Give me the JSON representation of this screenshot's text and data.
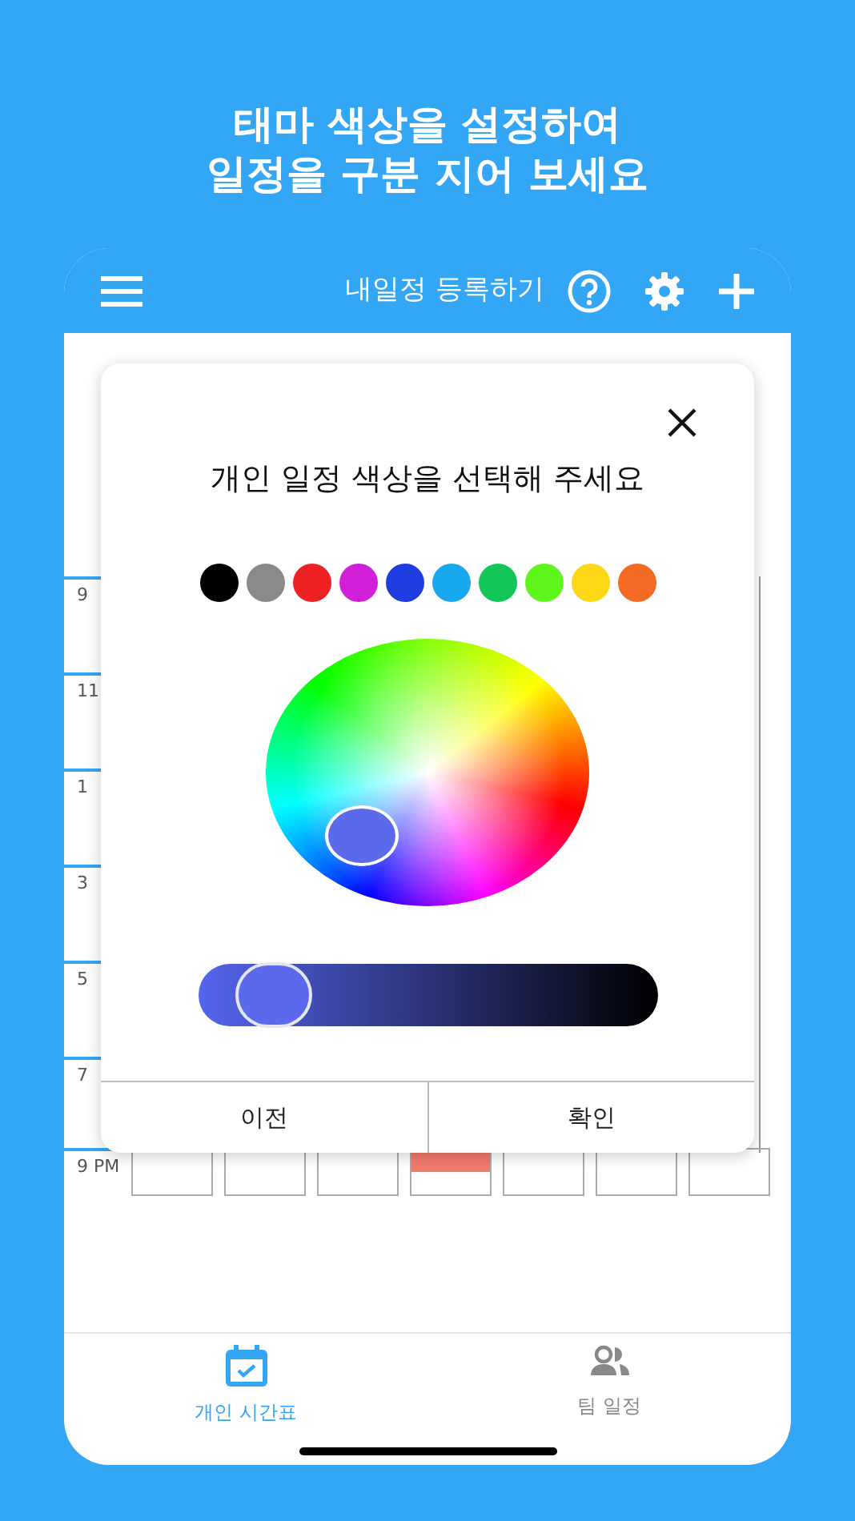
{
  "headline": [
    "태마 색상을 설정하여",
    "일정을 구분 지어 보세요"
  ],
  "header": {
    "title": "내일정 등록하기"
  },
  "timetable": {
    "times": [
      "9",
      "11",
      "1",
      "3",
      "5",
      "7"
    ],
    "last_row": {
      "time": "9 PM",
      "cells": [
        {
          "filled": false
        },
        {
          "filled": false
        },
        {
          "filled": false
        },
        {
          "filled": true
        },
        {
          "filled": false
        },
        {
          "filled": false
        },
        {
          "filled": false
        }
      ]
    }
  },
  "dialog": {
    "title": "개인 일정 색상을 선택해 주세요",
    "swatches": [
      {
        "color": "#000000"
      },
      {
        "color": "#8a8a8a"
      },
      {
        "color": "#ee2222"
      },
      {
        "color": "#d21fd8"
      },
      {
        "color": "#1f3de0"
      },
      {
        "color": "#18a8ee"
      },
      {
        "color": "#12c658"
      },
      {
        "color": "#5ef51a"
      },
      {
        "color": "#fcd716"
      },
      {
        "color": "#f26a23"
      }
    ],
    "picker": {
      "color": "#5a6aeb"
    },
    "brightness": {
      "level": 0.1
    },
    "buttons": [
      "이전",
      "확인"
    ]
  },
  "tabs": [
    {
      "label": "개인 시간표",
      "selected": true
    },
    {
      "label": "팀 일정",
      "selected": false
    }
  ]
}
